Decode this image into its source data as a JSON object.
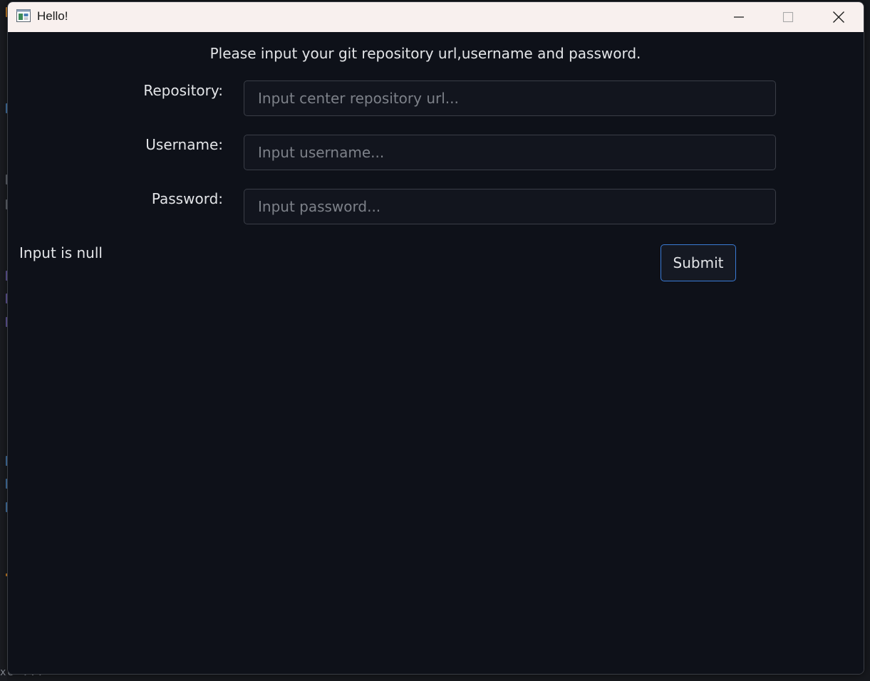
{
  "window": {
    "title": "Hello!",
    "controls": {
      "minimize": "minimize-icon",
      "maximize": "maximize-icon",
      "close": "close-icon"
    }
  },
  "form": {
    "header": "Please input your git repository url,username and password.",
    "repository": {
      "label": "Repository:",
      "placeholder": "Input center repository url...",
      "value": ""
    },
    "username": {
      "label": "Username:",
      "placeholder": "Input username...",
      "value": ""
    },
    "password": {
      "label": "Password:",
      "placeholder": "Input password...",
      "value": ""
    },
    "status": "Input is null",
    "submit_label": "Submit"
  },
  "background": {
    "bottom_text": "xe  ..."
  },
  "colors": {
    "titlebar": "#f8f0ee",
    "window_bg": "#0e1119",
    "input_bg": "#12151e",
    "input_border": "#3a3e47",
    "accent_border": "#3a7bd5",
    "text": "#e3e5e8",
    "placeholder": "#7d8189"
  }
}
